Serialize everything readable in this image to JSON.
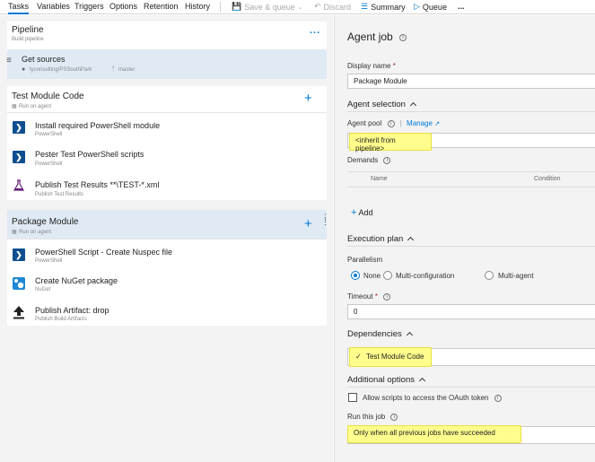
{
  "tabs": [
    {
      "label": "Tasks"
    },
    {
      "label": "Variables"
    },
    {
      "label": "Triggers"
    },
    {
      "label": "Options"
    },
    {
      "label": "Retention"
    },
    {
      "label": "History"
    }
  ],
  "toolbar": {
    "save": "Save & queue",
    "discard": "Discard",
    "summary": "Summary",
    "queue": "Queue",
    "more": "..."
  },
  "pipeline": {
    "title": "Pipeline",
    "subtitle": "Build pipeline",
    "more": "..."
  },
  "get_sources": {
    "title": "Get sources",
    "repo": "tyconsulting/PSSouthPark",
    "branch": "master"
  },
  "jobs": [
    {
      "title": "Test Module Code",
      "subtitle": "Run on agent",
      "tasks": [
        {
          "title": "Install required PowerShell module",
          "subtitle": "PowerShell",
          "icon": "powershell-icon"
        },
        {
          "title": "Pester Test PowerShell scripts",
          "subtitle": "PowerShell",
          "icon": "powershell-icon"
        },
        {
          "title": "Publish Test Results **\\TEST-*.xml",
          "subtitle": "Publish Test Results",
          "icon": "flask-icon"
        }
      ]
    },
    {
      "title": "Package Module",
      "subtitle": "Run on agent",
      "tasks": [
        {
          "title": "PowerShell Script - Create Nuspec file",
          "subtitle": "PowerShell",
          "icon": "powershell-icon"
        },
        {
          "title": "Create NuGet package",
          "subtitle": "NuGet",
          "icon": "nuget-icon"
        },
        {
          "title": "Publish Artifact: drop",
          "subtitle": "Publish Build Artifacts",
          "icon": "upload-arrow-icon"
        }
      ]
    }
  ],
  "agent_job": {
    "title": "Agent job",
    "display_name_label": "Display name",
    "required_mark": "*",
    "display_name_value": "Package Module",
    "agent_selection": "Agent selection",
    "agent_pool_label": "Agent pool",
    "pipe": "|",
    "manage": "Manage",
    "agent_pool_value": "<inherit from pipeline>",
    "demands_label": "Demands",
    "demands_col_name": "Name",
    "demands_col_condition": "Condition",
    "add": "Add",
    "execution_plan": "Execution plan",
    "parallelism_label": "Parallelism",
    "parallelism_options": [
      "None",
      "Multi-configuration",
      "Multi-agent"
    ],
    "timeout_label": "Timeout",
    "timeout_value": "0",
    "dependencies": "Dependencies",
    "dependency_value": "Test Module Code",
    "additional_options": "Additional options",
    "oauth_label": "Allow scripts to access the OAuth token",
    "run_this_job_label": "Run this job",
    "run_this_job_value": "Only when all previous jobs have succeeded"
  },
  "colors": {
    "accent": "#0078d4",
    "highlight": "#fffd8c",
    "selected_job": "#dfeaf5",
    "powershell": "#0f4f8f"
  }
}
